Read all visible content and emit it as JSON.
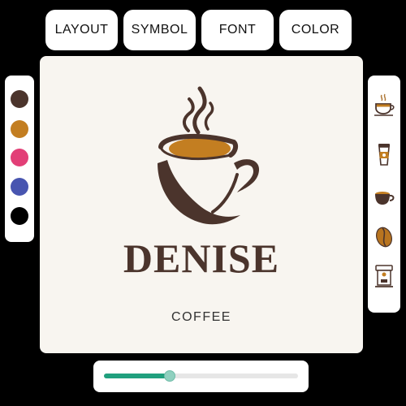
{
  "tabs": [
    {
      "label": "LAYOUT"
    },
    {
      "label": "SYMBOL"
    },
    {
      "label": "FONT"
    },
    {
      "label": "COLOR"
    }
  ],
  "logo": {
    "name": "DENISE",
    "tagline": "COFFEE",
    "colors": {
      "primary": "#4b342c",
      "accent": "#c37e21",
      "background": "#f8f5f0"
    }
  },
  "palette": [
    {
      "name": "brown",
      "color": "#4b342c"
    },
    {
      "name": "amber",
      "color": "#c37e21"
    },
    {
      "name": "pink",
      "color": "#e23f77"
    },
    {
      "name": "indigo",
      "color": "#4855b0"
    },
    {
      "name": "black",
      "color": "#000000"
    }
  ],
  "symbols": [
    {
      "icon": "steaming-cup-icon"
    },
    {
      "icon": "takeaway-cup-icon"
    },
    {
      "icon": "coffee-cup-icon"
    },
    {
      "icon": "coffee-bean-icon"
    },
    {
      "icon": "espresso-machine-icon"
    }
  ],
  "slider": {
    "value": 0.34,
    "fill_color": "#20a07e"
  }
}
